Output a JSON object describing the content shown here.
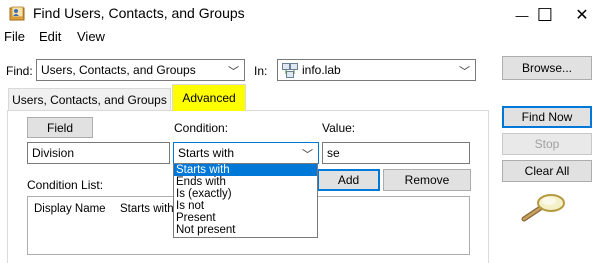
{
  "window": {
    "title": "Find Users, Contacts, and Groups",
    "minimize_glyph": "—",
    "maximize_glyph": "☐",
    "close_glyph": "✕"
  },
  "menu": [
    "File",
    "Edit",
    "View"
  ],
  "find_row": {
    "find_label": "Find:",
    "find_value": "Users, Contacts, and Groups",
    "in_label": "In:",
    "in_value": "info.lab",
    "browse_label": "Browse..."
  },
  "tabs": [
    {
      "label": "Users, Contacts, and Groups",
      "active": false
    },
    {
      "label": "Advanced",
      "active": true
    }
  ],
  "advanced": {
    "field_button": "Field",
    "condition_label": "Condition:",
    "value_label": "Value:",
    "field_value": "Division",
    "condition_value": "Starts with",
    "value_value": "se",
    "condition_options": [
      "Starts with",
      "Ends with",
      "Is (exactly)",
      "Is not",
      "Present",
      "Not present"
    ],
    "condition_list_label": "Condition List:",
    "add_button": "Add",
    "remove_button": "Remove",
    "list_columns": [
      "Display Name",
      "Starts with"
    ]
  },
  "actions": {
    "find_now": "Find Now",
    "stop": "Stop",
    "clear_all": "Clear All"
  },
  "icons": {
    "title": "address-book-icon",
    "domain": "domain-icon",
    "search": "magnifier-icon"
  },
  "colors": {
    "highlight": "#ffff00",
    "selection": "#0078d7",
    "default_button_border": "#0078d7"
  }
}
